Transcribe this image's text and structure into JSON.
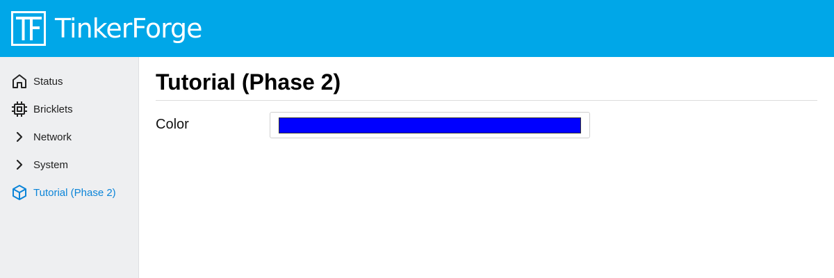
{
  "app": {
    "logo_text": "TinkerForge",
    "logo_icon": "tinkerforge-logo-icon"
  },
  "sidebar": {
    "items": [
      {
        "label": "Status",
        "icon": "home-icon",
        "active": false
      },
      {
        "label": "Bricklets",
        "icon": "chip-icon",
        "active": false
      },
      {
        "label": "Network",
        "icon": "chevron-right-icon",
        "active": false
      },
      {
        "label": "System",
        "icon": "chevron-right-icon",
        "active": false
      },
      {
        "label": "Tutorial (Phase 2)",
        "icon": "box-icon",
        "active": true
      }
    ]
  },
  "main": {
    "title": "Tutorial (Phase 2)",
    "form": {
      "color_label": "Color",
      "color_value": "#0000ff"
    }
  },
  "colors": {
    "header": "#00a7e8",
    "sidebar": "#eeeff1",
    "active": "#0a84d8"
  }
}
